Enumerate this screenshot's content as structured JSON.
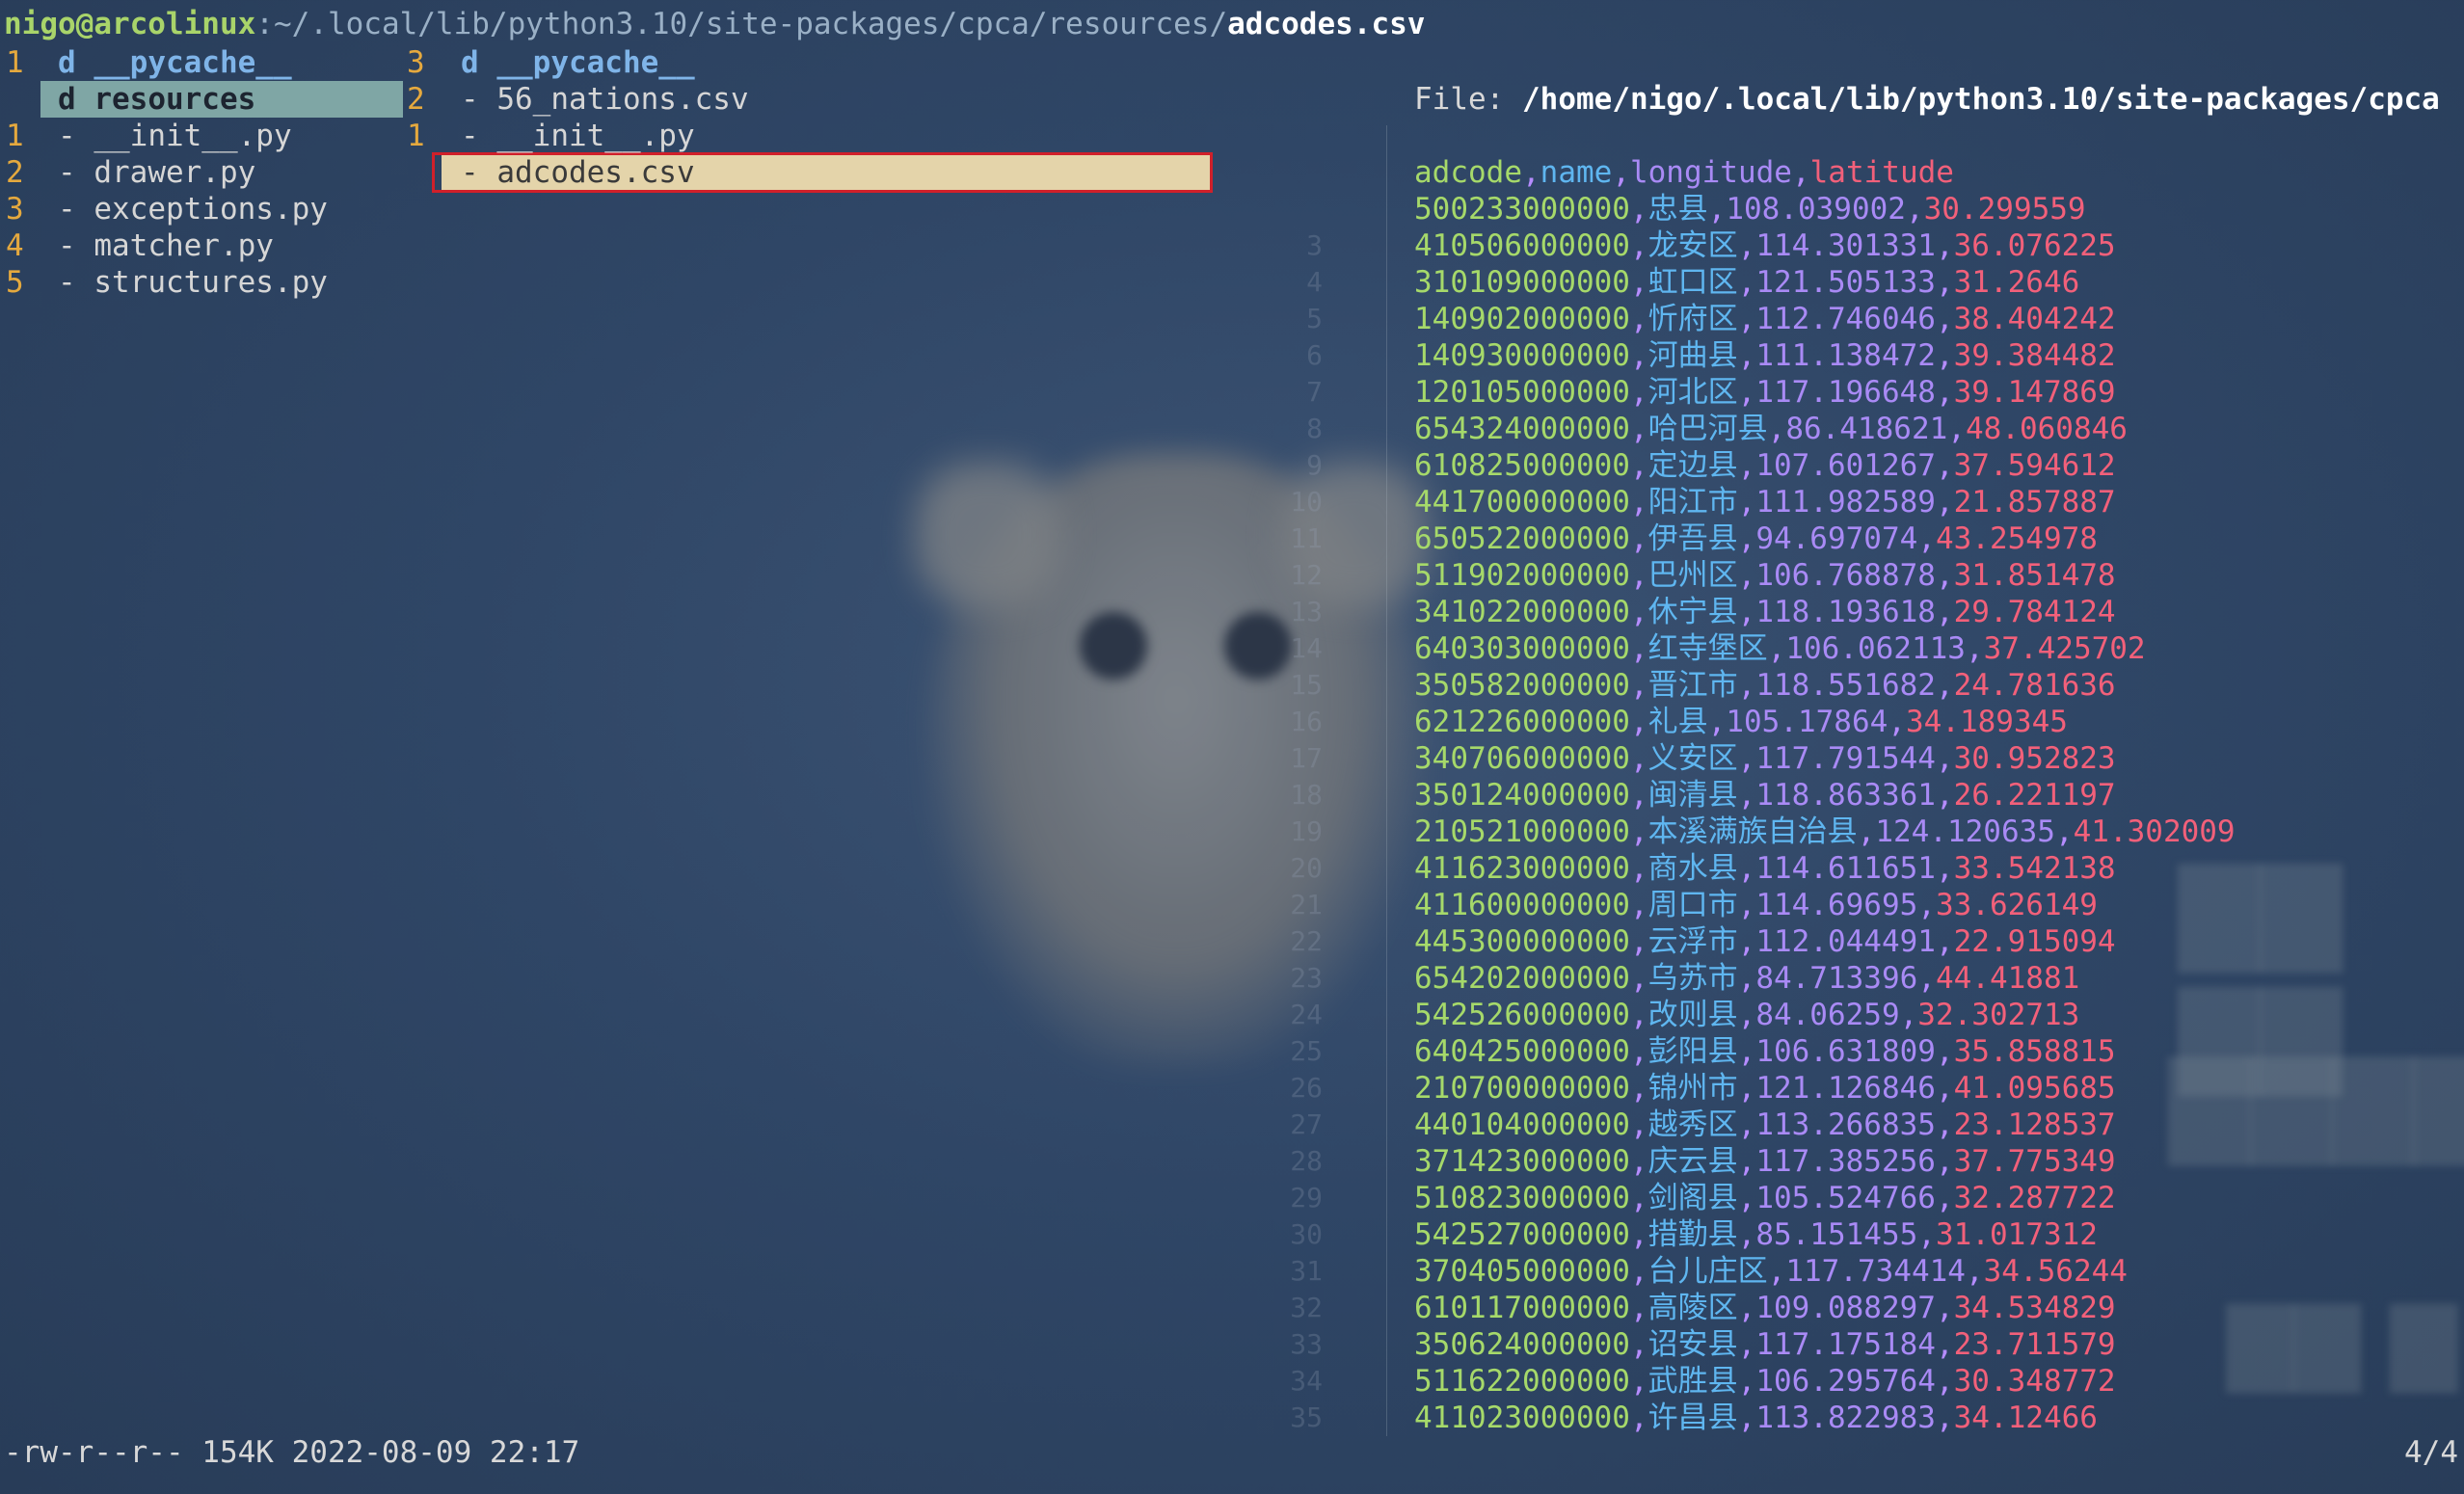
{
  "title": {
    "user_host": "nigo@arcolinux",
    "path": ":~/.local/lib/python3.10/site-packages/cpca/resources/",
    "file": "adcodes.csv"
  },
  "parent_column": [
    {
      "num": "1",
      "type": "d",
      "name": "__pycache__"
    },
    {
      "num": "",
      "type": "d",
      "name": "resources",
      "selected": true
    },
    {
      "num": "1",
      "type": "-",
      "name": "__init__.py"
    },
    {
      "num": "2",
      "type": "-",
      "name": "drawer.py"
    },
    {
      "num": "3",
      "type": "-",
      "name": "exceptions.py"
    },
    {
      "num": "4",
      "type": "-",
      "name": "matcher.py"
    },
    {
      "num": "5",
      "type": "-",
      "name": "structures.py"
    }
  ],
  "current_column": [
    {
      "num": "3",
      "type": "d",
      "name": "__pycache__"
    },
    {
      "num": "2",
      "type": "-",
      "name": "56_nations.csv"
    },
    {
      "num": "1",
      "type": "-",
      "name": "__init__.py"
    },
    {
      "num": "",
      "type": "-",
      "name": "adcodes.csv",
      "selected": true
    }
  ],
  "preview": {
    "file_label": "File:",
    "file_path": "/home/nigo/.local/lib/python3.10/site-packages/cpca",
    "header": [
      "adcode",
      "name",
      "longitude",
      "latitude"
    ],
    "rows": [
      [
        "500233000000",
        "忠县",
        "108.039002",
        "30.299559"
      ],
      [
        "410506000000",
        "龙安区",
        "114.301331",
        "36.076225"
      ],
      [
        "310109000000",
        "虹口区",
        "121.505133",
        "31.2646"
      ],
      [
        "140902000000",
        "忻府区",
        "112.746046",
        "38.404242"
      ],
      [
        "140930000000",
        "河曲县",
        "111.138472",
        "39.384482"
      ],
      [
        "120105000000",
        "河北区",
        "117.196648",
        "39.147869"
      ],
      [
        "654324000000",
        "哈巴河县",
        "86.418621",
        "48.060846"
      ],
      [
        "610825000000",
        "定边县",
        "107.601267",
        "37.594612"
      ],
      [
        "441700000000",
        "阳江市",
        "111.982589",
        "21.857887"
      ],
      [
        "650522000000",
        "伊吾县",
        "94.697074",
        "43.254978"
      ],
      [
        "511902000000",
        "巴州区",
        "106.768878",
        "31.851478"
      ],
      [
        "341022000000",
        "休宁县",
        "118.193618",
        "29.784124"
      ],
      [
        "640303000000",
        "红寺堡区",
        "106.062113",
        "37.425702"
      ],
      [
        "350582000000",
        "晋江市",
        "118.551682",
        "24.781636"
      ],
      [
        "621226000000",
        "礼县",
        "105.17864",
        "34.189345"
      ],
      [
        "340706000000",
        "义安区",
        "117.791544",
        "30.952823"
      ],
      [
        "350124000000",
        "闽清县",
        "118.863361",
        "26.221197"
      ],
      [
        "210521000000",
        "本溪满族自治县",
        "124.120635",
        "41.302009"
      ],
      [
        "411623000000",
        "商水县",
        "114.611651",
        "33.542138"
      ],
      [
        "411600000000",
        "周口市",
        "114.69695",
        "33.626149"
      ],
      [
        "445300000000",
        "云浮市",
        "112.044491",
        "22.915094"
      ],
      [
        "654202000000",
        "乌苏市",
        "84.713396",
        "44.41881"
      ],
      [
        "542526000000",
        "改则县",
        "84.06259",
        "32.302713"
      ],
      [
        "640425000000",
        "彭阳县",
        "106.631809",
        "35.858815"
      ],
      [
        "210700000000",
        "锦州市",
        "121.126846",
        "41.095685"
      ],
      [
        "440104000000",
        "越秀区",
        "113.266835",
        "23.128537"
      ],
      [
        "371423000000",
        "庆云县",
        "117.385256",
        "37.775349"
      ],
      [
        "510823000000",
        "剑阁县",
        "105.524766",
        "32.287722"
      ],
      [
        "542527000000",
        "措勤县",
        "85.151455",
        "31.017312"
      ],
      [
        "370405000000",
        "台儿庄区",
        "117.734414",
        "34.56244"
      ],
      [
        "610117000000",
        "高陵区",
        "109.088297",
        "34.534829"
      ],
      [
        "350624000000",
        "诏安县",
        "117.175184",
        "23.711579"
      ],
      [
        "511622000000",
        "武胜县",
        "106.295764",
        "30.348772"
      ],
      [
        "411023000000",
        "许昌县",
        "113.822983",
        "34.12466"
      ]
    ],
    "line_numbers": [
      "3",
      "4",
      "5",
      "6",
      "7",
      "8",
      "9",
      "10",
      "11",
      "12",
      "13",
      "14",
      "15",
      "16",
      "17",
      "18",
      "19",
      "20",
      "21",
      "22",
      "23",
      "24",
      "25",
      "26",
      "27",
      "28",
      "29",
      "30",
      "31",
      "32",
      "33",
      "34",
      "35"
    ]
  },
  "status": {
    "info": "-rw-r--r-- 154K 2022-08-09 22:17",
    "pager": "4/4"
  }
}
